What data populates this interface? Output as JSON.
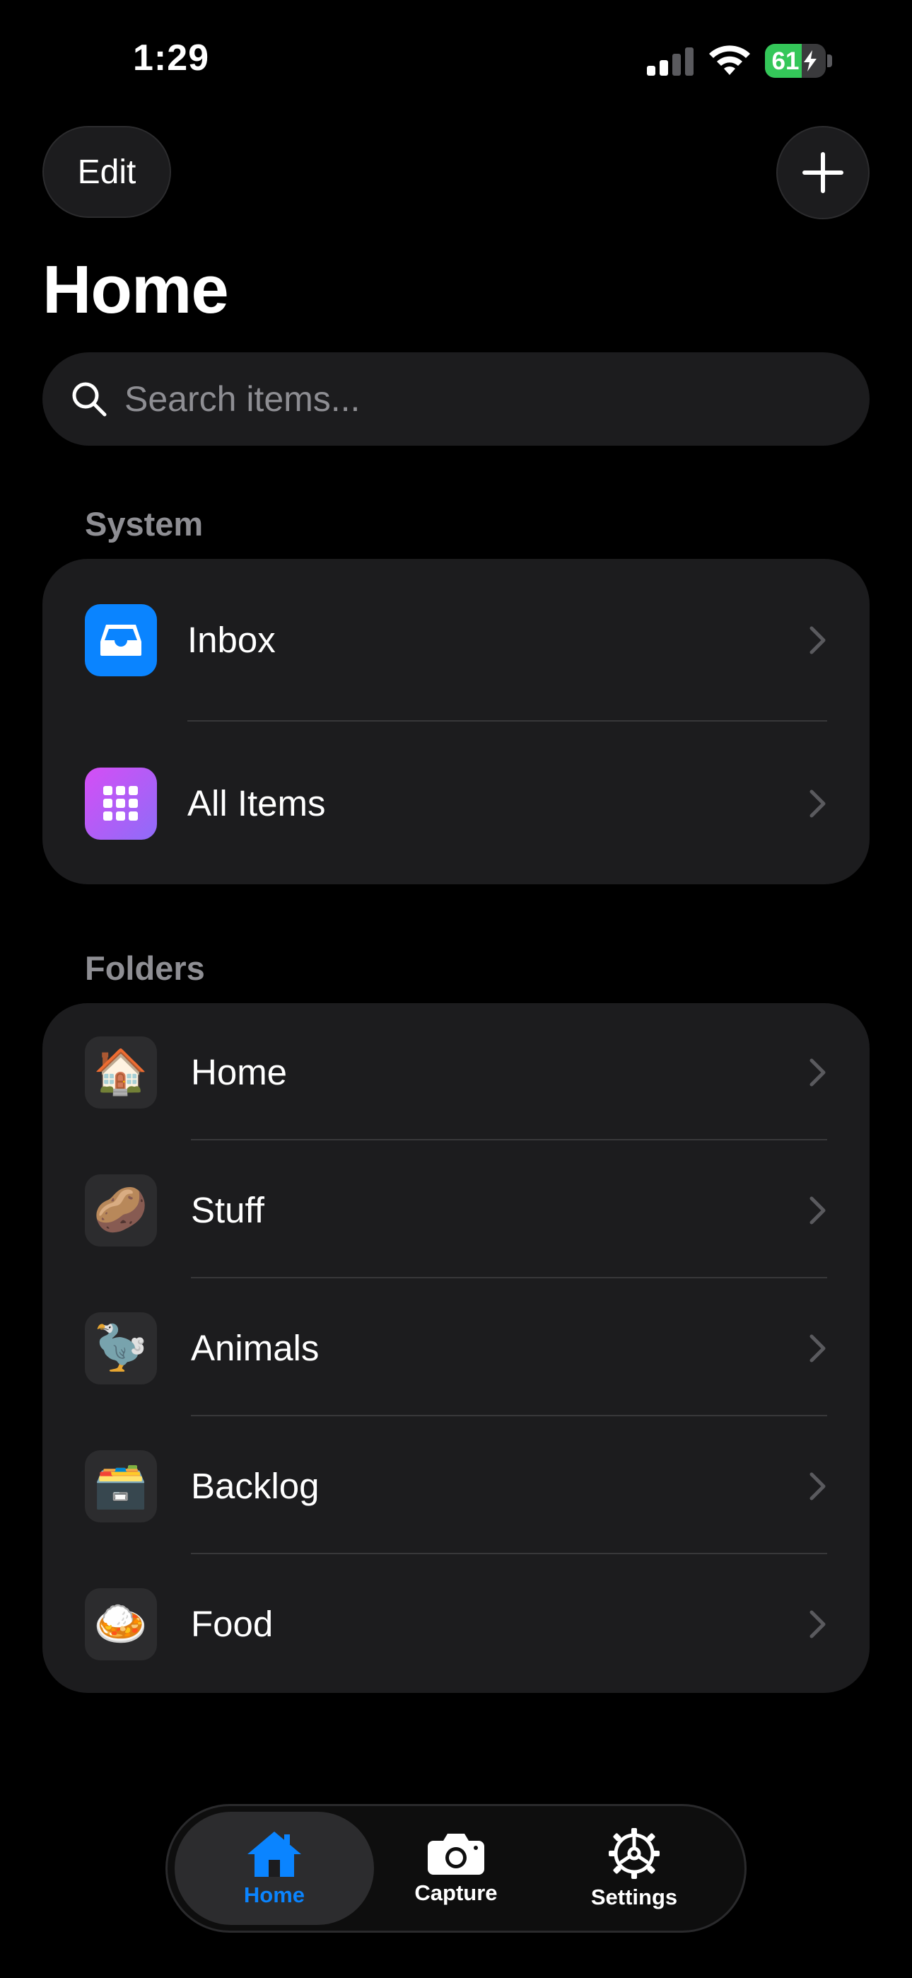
{
  "status_bar": {
    "time": "1:29",
    "battery": "61"
  },
  "header": {
    "edit_label": "Edit",
    "title": "Home"
  },
  "search": {
    "placeholder": "Search items..."
  },
  "system": {
    "label": "System",
    "items": [
      {
        "label": "Inbox",
        "icon": "inbox-icon",
        "color": "#0a84ff"
      },
      {
        "label": "All Items",
        "icon": "grid-icon",
        "color": "#bf5af2"
      }
    ]
  },
  "folders": {
    "label": "Folders",
    "items": [
      {
        "label": "Home",
        "icon": "🏠"
      },
      {
        "label": "Stuff",
        "icon": "🥔"
      },
      {
        "label": "Animals",
        "icon": "🦤"
      },
      {
        "label": "Backlog",
        "icon": "🗃️"
      },
      {
        "label": "Food",
        "icon": "🍛"
      }
    ]
  },
  "tabbar": {
    "active_color": "#0a84ff",
    "tabs": [
      {
        "label": "Home",
        "icon": "house-icon"
      },
      {
        "label": "Capture",
        "icon": "camera-icon"
      },
      {
        "label": "Settings",
        "icon": "gear-icon"
      }
    ]
  }
}
